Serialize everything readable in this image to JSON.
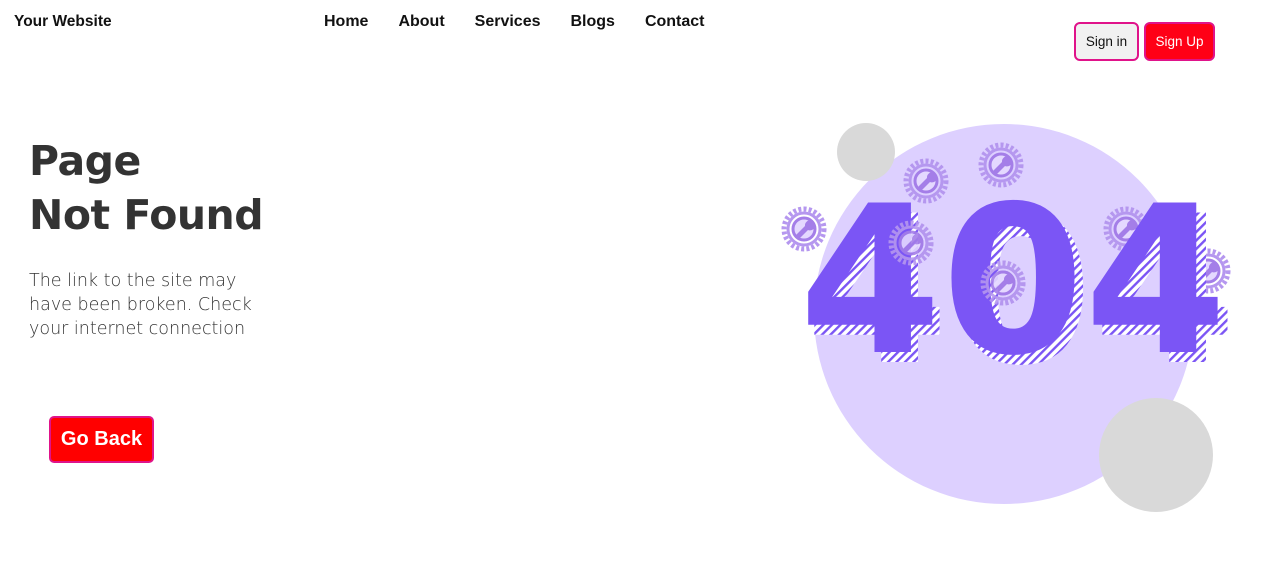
{
  "header": {
    "brand": "Your Website",
    "nav": [
      "Home",
      "About",
      "Services",
      "Blogs",
      "Contact"
    ],
    "signin_label": "Sign in",
    "signup_label": "Sign Up"
  },
  "main": {
    "title_line1": "Page",
    "title_line2": "Not Found",
    "description": "The link to the site may have been broken. Check your internet connection",
    "back_label": "Go Back"
  },
  "illustration": {
    "error_code": "404",
    "icon": "wrench-gear-icon"
  },
  "colors": {
    "accent_red": "#ff0000",
    "border_pink": "#e0138a",
    "purple": "#7b55f5",
    "lavender": "#ddd0ff",
    "grey_circle": "#d9d9d9"
  }
}
